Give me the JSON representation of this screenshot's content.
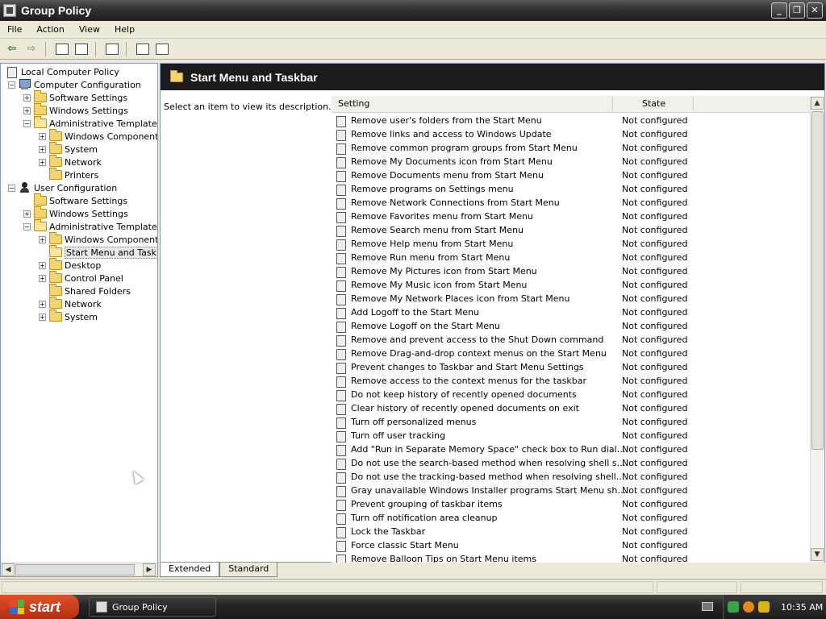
{
  "window": {
    "title": "Group Policy",
    "buttons": {
      "minimize": "_",
      "restore": "❐",
      "close": "✕"
    }
  },
  "menubar": {
    "items": [
      "File",
      "Action",
      "View",
      "Help"
    ]
  },
  "toolbar": {
    "items": [
      "back-arrow-icon",
      "forward-arrow-icon",
      "up-folder-icon",
      "show-hide-tree-icon",
      "export-list-icon",
      "help-icon",
      "properties-icon"
    ]
  },
  "tree": {
    "root": "Local Computer Policy",
    "computer": {
      "label": "Computer Configuration",
      "software": "Software Settings",
      "windows": "Windows Settings",
      "admin": "Administrative Templates",
      "children": [
        "Windows Components",
        "System",
        "Network",
        "Printers"
      ]
    },
    "user": {
      "label": "User Configuration",
      "software": "Software Settings",
      "windows": "Windows Settings",
      "admin": "Administrative Templates",
      "children": [
        "Windows Components",
        "Start Menu and Taskba",
        "Desktop",
        "Control Panel",
        "Shared Folders",
        "Network",
        "System"
      ]
    }
  },
  "detail": {
    "header_title": "Start Menu and Taskbar",
    "description": "Select an item to view its description.",
    "columns": {
      "setting": "Setting",
      "state": "State"
    },
    "rows": [
      {
        "setting": "Remove user's folders from the Start Menu",
        "state": "Not configured"
      },
      {
        "setting": "Remove links and access to Windows Update",
        "state": "Not configured"
      },
      {
        "setting": "Remove common program groups from Start Menu",
        "state": "Not configured"
      },
      {
        "setting": "Remove My Documents icon from Start Menu",
        "state": "Not configured"
      },
      {
        "setting": "Remove Documents menu from Start Menu",
        "state": "Not configured"
      },
      {
        "setting": "Remove programs on Settings menu",
        "state": "Not configured"
      },
      {
        "setting": "Remove Network Connections from Start Menu",
        "state": "Not configured"
      },
      {
        "setting": "Remove Favorites menu from Start Menu",
        "state": "Not configured"
      },
      {
        "setting": "Remove Search menu from Start Menu",
        "state": "Not configured"
      },
      {
        "setting": "Remove Help menu from Start Menu",
        "state": "Not configured"
      },
      {
        "setting": "Remove Run menu from Start Menu",
        "state": "Not configured"
      },
      {
        "setting": "Remove My Pictures icon from Start Menu",
        "state": "Not configured"
      },
      {
        "setting": "Remove My Music icon from Start Menu",
        "state": "Not configured"
      },
      {
        "setting": "Remove My Network Places icon from Start Menu",
        "state": "Not configured"
      },
      {
        "setting": "Add Logoff to the Start Menu",
        "state": "Not configured"
      },
      {
        "setting": "Remove Logoff on the Start Menu",
        "state": "Not configured"
      },
      {
        "setting": "Remove and prevent access to the Shut Down command",
        "state": "Not configured"
      },
      {
        "setting": "Remove Drag-and-drop context menus on the Start Menu",
        "state": "Not configured"
      },
      {
        "setting": "Prevent changes to Taskbar and Start Menu Settings",
        "state": "Not configured"
      },
      {
        "setting": "Remove access to the context menus for the taskbar",
        "state": "Not configured"
      },
      {
        "setting": "Do not keep history of recently opened documents",
        "state": "Not configured"
      },
      {
        "setting": "Clear history of recently opened documents on exit",
        "state": "Not configured"
      },
      {
        "setting": "Turn off personalized menus",
        "state": "Not configured"
      },
      {
        "setting": "Turn off user tracking",
        "state": "Not configured"
      },
      {
        "setting": "Add \"Run in Separate Memory Space\" check box to Run dialog box",
        "state": "Not configured"
      },
      {
        "setting": "Do not use the search-based method when resolving shell shortcuts",
        "state": "Not configured"
      },
      {
        "setting": "Do not use the tracking-based method when resolving shell short...",
        "state": "Not configured"
      },
      {
        "setting": "Gray unavailable Windows Installer programs Start Menu shortcuts",
        "state": "Not configured"
      },
      {
        "setting": "Prevent grouping of taskbar items",
        "state": "Not configured"
      },
      {
        "setting": "Turn off notification area cleanup",
        "state": "Not configured"
      },
      {
        "setting": "Lock the Taskbar",
        "state": "Not configured"
      },
      {
        "setting": "Force classic Start Menu",
        "state": "Not configured"
      },
      {
        "setting": "Remove Balloon Tips on Start Menu items",
        "state": "Not configured"
      }
    ],
    "tabs": [
      "Extended",
      "Standard"
    ]
  },
  "taskbar": {
    "start_label": "start",
    "task_label": "Group Policy",
    "clock": "10:35 AM"
  },
  "colors": {
    "title_bar": "#2a2a2a",
    "start_button": "#c8421c",
    "folder": "#f5d56a"
  }
}
